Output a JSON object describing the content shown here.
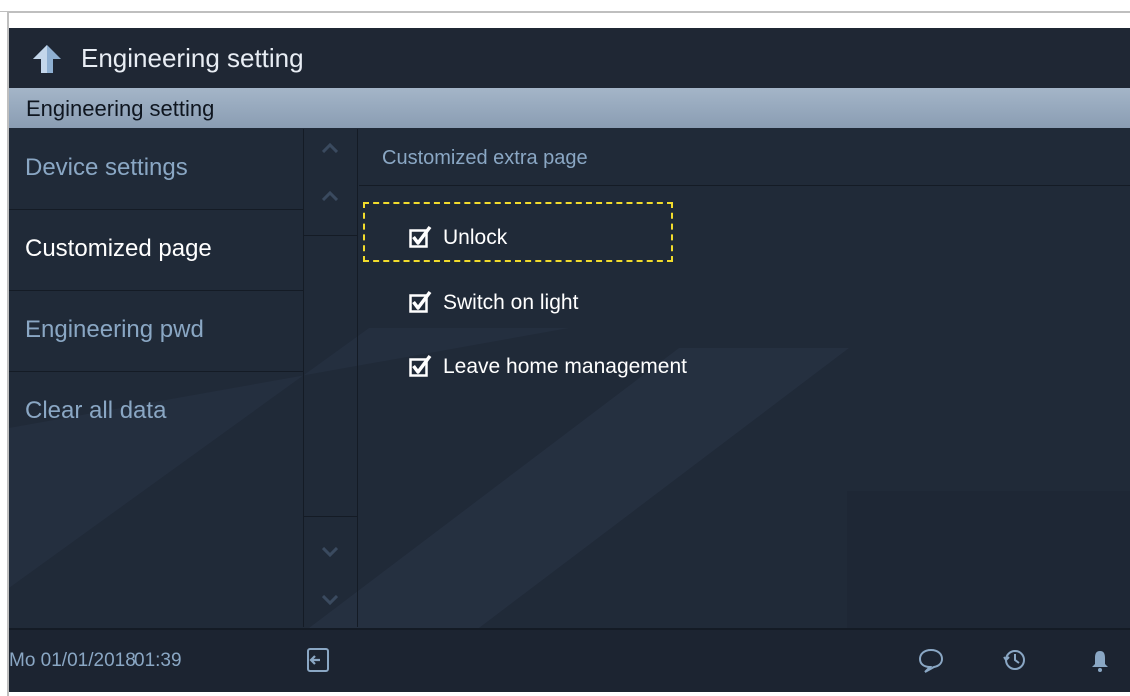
{
  "app": {
    "title": "Engineering setting"
  },
  "section": {
    "header": "Engineering setting"
  },
  "sidebar": {
    "items": [
      {
        "label": "Device settings",
        "active": false
      },
      {
        "label": "Customized page",
        "active": true
      },
      {
        "label": "Engineering pwd",
        "active": false
      },
      {
        "label": "Clear all data",
        "active": false
      }
    ]
  },
  "content": {
    "title": "Customized extra page",
    "options": [
      {
        "label": "Unlock",
        "checked": true,
        "focused": true
      },
      {
        "label": "Switch on light",
        "checked": true,
        "focused": false
      },
      {
        "label": "Leave home management",
        "checked": true,
        "focused": false
      }
    ]
  },
  "status": {
    "date": "Mo 01/01/2018",
    "time": "01:39"
  },
  "icons": {
    "back": "back-arrow-icon",
    "exit": "exit-door-icon",
    "message": "message-bubble-icon",
    "history": "history-clock-icon",
    "bell": "bell-icon",
    "scroll_up": "chevron-up-icon",
    "scroll_down": "chevron-down-icon"
  },
  "colors": {
    "background": "#202a38",
    "header_gradient_top": "#a4b5c8",
    "accent_text": "#8aa7c4",
    "focus_outline": "#f2dc2c"
  }
}
